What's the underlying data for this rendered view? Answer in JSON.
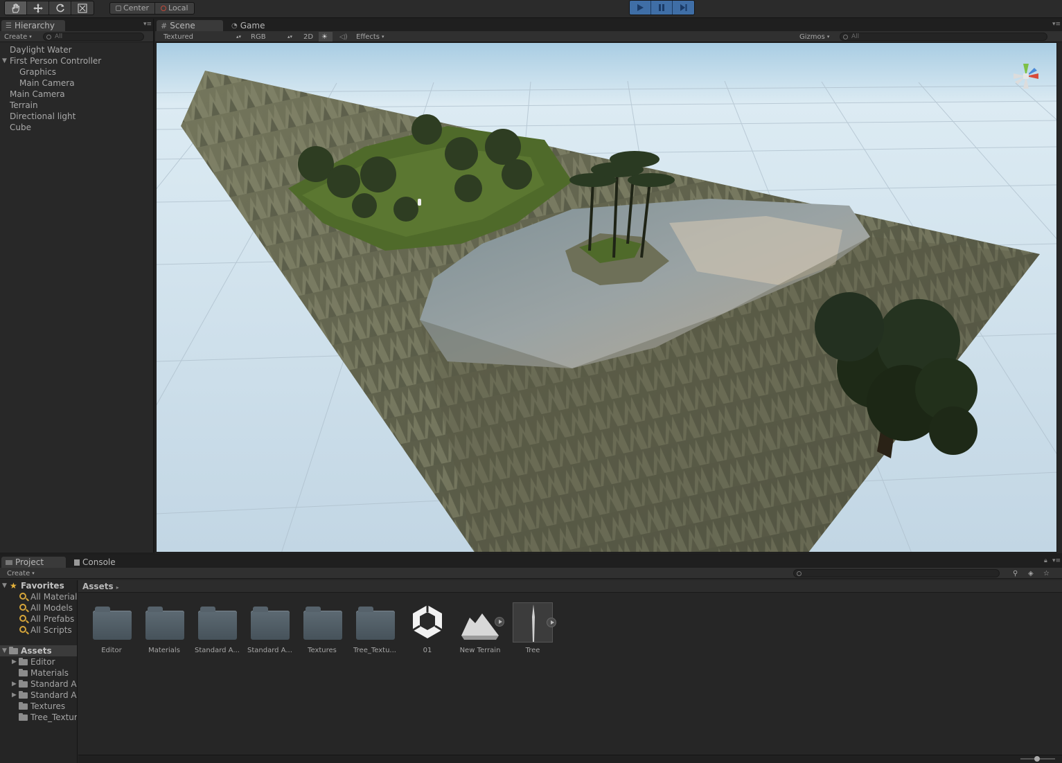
{
  "toolbar": {
    "pivot": "Center",
    "space": "Local"
  },
  "hierarchy": {
    "tab": "Hierarchy",
    "create": "Create",
    "search_placeholder": "All",
    "items": [
      {
        "label": "Daylight Water",
        "indent": 0,
        "expanded": false
      },
      {
        "label": "First Person Controller",
        "indent": 0,
        "expanded": true
      },
      {
        "label": "Graphics",
        "indent": 1,
        "expanded": false
      },
      {
        "label": "Main Camera",
        "indent": 1,
        "expanded": false
      },
      {
        "label": "Main Camera",
        "indent": 0,
        "expanded": false
      },
      {
        "label": "Terrain",
        "indent": 0,
        "expanded": false
      },
      {
        "label": "Directional light",
        "indent": 0,
        "expanded": false
      },
      {
        "label": "Cube",
        "indent": 0,
        "expanded": false
      }
    ]
  },
  "scene": {
    "tab_scene": "Scene",
    "tab_game": "Game",
    "shading": "Textured",
    "render_mode": "RGB",
    "mode_2d": "2D",
    "effects": "Effects",
    "gizmos": "Gizmos",
    "search_placeholder": "All"
  },
  "project": {
    "tab_project": "Project",
    "tab_console": "Console",
    "create": "Create",
    "favorites_label": "Favorites",
    "favorites": [
      "All Materials",
      "All Models",
      "All Prefabs",
      "All Scripts"
    ],
    "assets_label": "Assets",
    "asset_tree": [
      {
        "label": "Editor",
        "has_children": true
      },
      {
        "label": "Materials",
        "has_children": false
      },
      {
        "label": "Standard As",
        "has_children": true
      },
      {
        "label": "Standard As",
        "has_children": true
      },
      {
        "label": "Textures",
        "has_children": false
      },
      {
        "label": "Tree_Textur",
        "has_children": false
      }
    ],
    "breadcrumb": "Assets",
    "assets": [
      {
        "label": "Editor",
        "kind": "folder"
      },
      {
        "label": "Materials",
        "kind": "folder"
      },
      {
        "label": "Standard A...",
        "kind": "folder"
      },
      {
        "label": "Standard A...",
        "kind": "folder"
      },
      {
        "label": "Textures",
        "kind": "folder"
      },
      {
        "label": "Tree_Textu...",
        "kind": "folder"
      },
      {
        "label": "01",
        "kind": "unity-scene"
      },
      {
        "label": "New Terrain",
        "kind": "terrain"
      },
      {
        "label": "Tree",
        "kind": "tree"
      }
    ]
  },
  "colors": {
    "play_accent": "#3f6ea6",
    "sky": "#c7dcea",
    "water": "#8a9aa2",
    "rock": "#6a6b55",
    "grass": "#4f6a2a"
  }
}
